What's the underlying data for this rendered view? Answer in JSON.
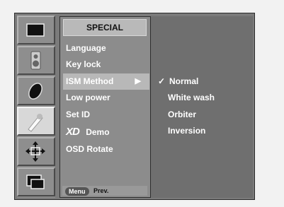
{
  "menu": {
    "title": "SPECIAL",
    "items": [
      {
        "label": "Language"
      },
      {
        "label": "Key lock"
      },
      {
        "label": "ISM Method",
        "has_submenu": true
      },
      {
        "label": "Low power"
      },
      {
        "label": "Set ID"
      },
      {
        "label": "Demo",
        "prefix_logo": "XD"
      },
      {
        "label": "OSD Rotate"
      }
    ],
    "selected_index": 2
  },
  "submenu": {
    "items": [
      "Normal",
      "White wash",
      "Orbiter",
      "Inversion"
    ],
    "checked_index": 0,
    "check_mark": "✓"
  },
  "footer": {
    "button_label": "Menu",
    "action_label": "Prev."
  },
  "icons": [
    {
      "name": "picture-icon"
    },
    {
      "name": "sound-speaker-icon"
    },
    {
      "name": "time-icon"
    },
    {
      "name": "special-icon",
      "active": true
    },
    {
      "name": "screen-icon"
    },
    {
      "name": "pip-icon"
    }
  ],
  "colors": {
    "menu_bg": "#8c8c8c",
    "submenu_bg": "#6f6f6f",
    "selected_bg": "#b8b8b8",
    "text": "#ffffff"
  }
}
